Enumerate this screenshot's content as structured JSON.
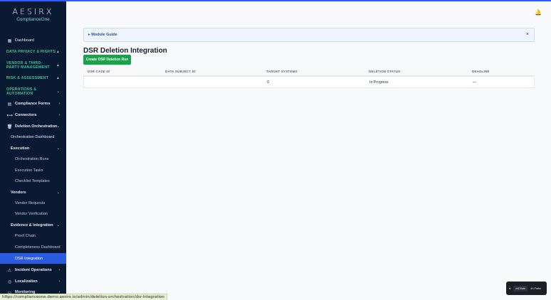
{
  "app": {
    "brand": "AESIRX",
    "product": "ComplianceOne"
  },
  "sidebar": {
    "dashboard": "Dashboard",
    "sections": {
      "privacy": "DATA PRIVACY & RIGHTS",
      "vendor": "VENDOR & THIRD-PARTY MANAGEMENT",
      "risk": "RISK & ASSESSMENT",
      "ops": "OPERATIONS & AUTOMATION"
    },
    "items": {
      "compliance_forms": "Compliance Forms",
      "connectors": "Connectors",
      "deletion_orchestration": "Deletion Orchestration",
      "orchestration_dashboard": "Orchestration Dashboard",
      "execution": "Execution",
      "orchestration_runs": "Orchestration Runs",
      "execution_tasks": "Execution Tasks",
      "checklist_templates": "Checklist Templates",
      "vendors": "Vendors",
      "vendor_requests": "Vendor Requests",
      "vendor_verification": "Vendor Verification",
      "evidence_integration": "Evidence & Integration",
      "proof_chain": "Proof Chain",
      "completeness_dashboard": "Completeness Dashboard",
      "dsr_integration": "DSR Integration",
      "incident_operations": "Incident Operations",
      "localization": "Localization",
      "monitoring": "Monitoring"
    }
  },
  "guide": {
    "label": "Module Guide"
  },
  "page": {
    "title": "DSR Deletion Integration",
    "create_button": "Create DSR Deletion Run"
  },
  "table": {
    "columns": [
      "DSR CASE ID",
      "DATA SUBJECT ID",
      "TARGET SYSTEMS",
      "DELETION STATUS",
      "DEADLINE"
    ],
    "rows": [
      {
        "case_id": "",
        "subject_id": "",
        "target_systems": "0",
        "status": "In Progress",
        "deadline": "—"
      }
    ]
  },
  "statusbar": {
    "url": "https://complianceone.demo.aesirx.io/admin/deletion-orchestration/dsr-integration"
  },
  "widget": {
    "label1": "esDitate",
    "label2": "4h Padw"
  },
  "colors": {
    "sidebar_bg": "#0b1a33",
    "accent_teal": "#36c29a",
    "active_blue": "#2b5bdf",
    "button_green": "#16a34a"
  }
}
